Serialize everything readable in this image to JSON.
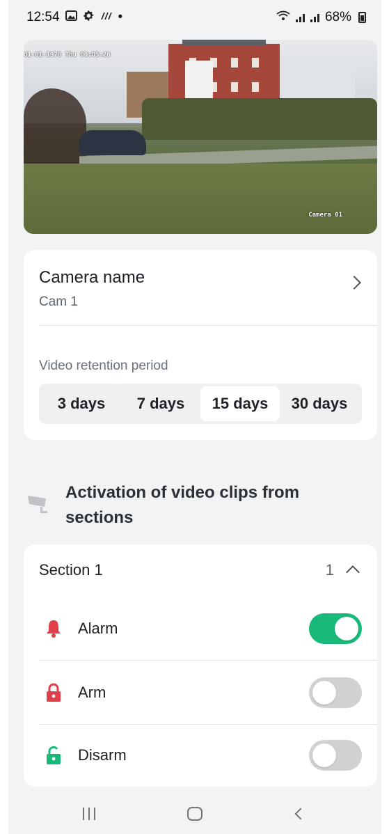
{
  "status_bar": {
    "time": "12:54",
    "battery": "68%",
    "icons": [
      "gallery-icon",
      "gear-icon",
      "nfc-icon",
      "wifi-icon",
      "signal-icon",
      "battery-icon"
    ],
    "dot": "•"
  },
  "camera_preview": {
    "timestamp": "01-01-1970 Thu 00:05:26",
    "overlay_label": "Camera 01"
  },
  "camera_card": {
    "name_title": "Camera name",
    "name_value": "Cam 1",
    "retention_label": "Video retention period",
    "retention_options": [
      "3 days",
      "7 days",
      "15 days",
      "30 days"
    ],
    "retention_selected": "15 days"
  },
  "activation": {
    "heading": "Activation of video clips from sections",
    "icon": "cctv-camera-icon"
  },
  "section": {
    "title": "Section 1",
    "count": "1",
    "expanded": true,
    "options": [
      {
        "label": "Alarm",
        "icon": "bell-icon",
        "icon_color": "#e0404a",
        "enabled": true
      },
      {
        "label": "Arm",
        "icon": "lock-icon",
        "icon_color": "#e0404a",
        "enabled": false
      },
      {
        "label": "Disarm",
        "icon": "unlock-icon",
        "icon_color": "#19b97a",
        "enabled": false
      }
    ]
  },
  "colors": {
    "accent_green": "#19b97a",
    "alert_red": "#e0404a",
    "background": "#f1f3f4"
  },
  "nav_bar": {
    "buttons": [
      "recents-icon",
      "home-icon",
      "back-icon"
    ]
  }
}
